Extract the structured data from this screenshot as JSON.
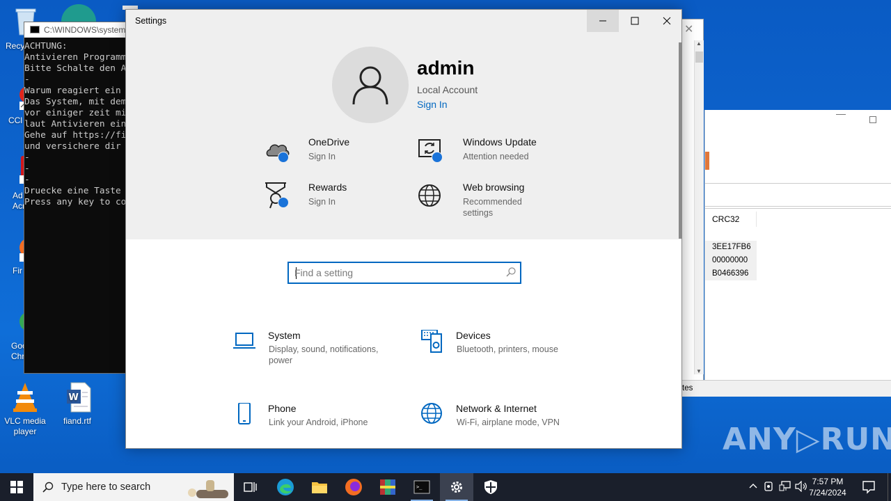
{
  "desktop": {
    "icons": [
      {
        "label": "Recy"
      },
      {
        "label": "CCl"
      },
      {
        "label": "Ad\nAcr"
      },
      {
        "label": "Fir"
      },
      {
        "label": "Goo\nChr"
      },
      {
        "label": "VLC media player"
      },
      {
        "label": "fiand.rtf"
      }
    ],
    "watermark": "ANY▷RUN"
  },
  "cmd_window": {
    "title": "C:\\WINDOWS\\system",
    "lines": [
      "ACHTUNG:",
      "Antivieren Programm",
      "Bitte Schalte den A",
      "-",
      "Warum reagiert ein",
      "Das System, mit dem",
      "vor einiger zeit mi",
      "laut Antivieren ein",
      "Gehe auf https://fi",
      "und versichere dir",
      "-",
      "-",
      "-",
      "Druecke eine Taste",
      "Press any key to co"
    ]
  },
  "background_window": {
    "column_header": "CRC32",
    "values": [
      "3EE17FB6",
      "00000000",
      "B0466396"
    ],
    "status_fragment": "tes"
  },
  "settings": {
    "window_title": "Settings",
    "account": {
      "name": "admin",
      "type": "Local Account",
      "sign_in": "Sign In"
    },
    "tiles": [
      {
        "title": "OneDrive",
        "subtitle": "Sign In",
        "icon": "cloud-icon"
      },
      {
        "title": "Windows Update",
        "subtitle": "Attention needed",
        "icon": "update-icon"
      },
      {
        "title": "Rewards",
        "subtitle": "Sign In",
        "icon": "rewards-icon"
      },
      {
        "title": "Web browsing",
        "subtitle": "Recommended settings",
        "icon": "globe-icon"
      }
    ],
    "search": {
      "placeholder": "Find a setting"
    },
    "categories": [
      {
        "title": "System",
        "subtitle": "Display, sound, notifications, power"
      },
      {
        "title": "Devices",
        "subtitle": "Bluetooth, printers, mouse"
      },
      {
        "title": "Phone",
        "subtitle": "Link your Android, iPhone"
      },
      {
        "title": "Network & Internet",
        "subtitle": "Wi-Fi, airplane mode, VPN"
      }
    ]
  },
  "taskbar": {
    "search_placeholder": "Type here to search",
    "time": "7:57 PM",
    "date": "7/24/2024"
  },
  "colors": {
    "accent": "#0067c0",
    "badge": "#1a73d9",
    "desktop": "#0d63cc",
    "taskbar": "#1a1f2b"
  }
}
